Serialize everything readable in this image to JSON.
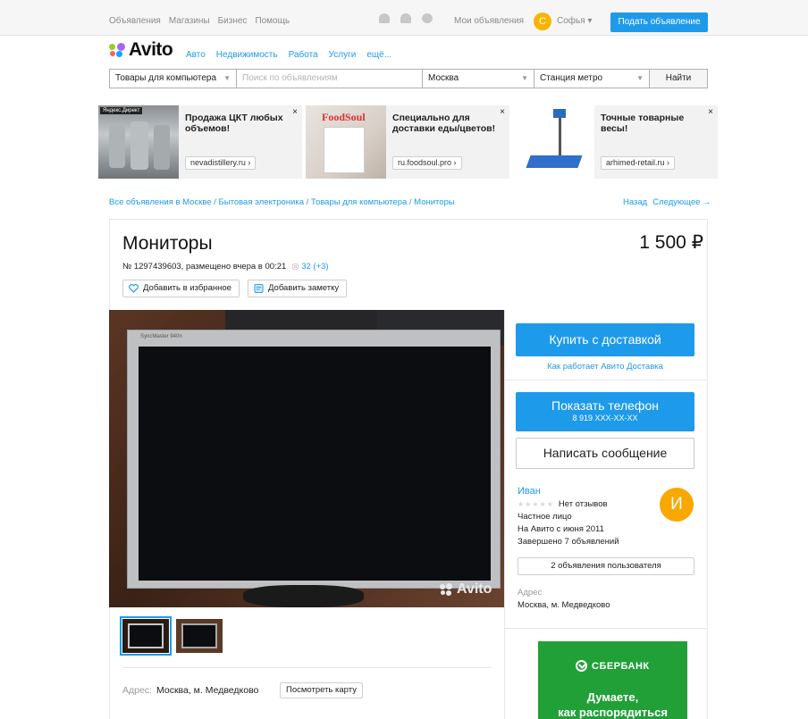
{
  "topbar": {
    "nav": [
      "Объявления",
      "Магазины",
      "Бизнес",
      "Помощь"
    ],
    "my_ads": "Мои объявления",
    "user_initial": "С",
    "user_name": "Софья ▾",
    "post_button": "Подать объявление",
    "icons": [
      "heart-icon",
      "bell-icon",
      "chat-icon"
    ]
  },
  "logo": {
    "text": "Avito"
  },
  "categories": [
    "Авто",
    "Недвижимость",
    "Работа",
    "Услуги",
    "ещё..."
  ],
  "search": {
    "category": "Товары для компьютера",
    "query_placeholder": "Поиск по объявлениям",
    "city": "Москва",
    "metro": "Станция метро",
    "find_button": "Найти"
  },
  "ads": [
    {
      "title": "Продажа ЦКТ любых объемов!",
      "link": "nevadistillery.ru ›",
      "badge": "Яндекс.Директ"
    },
    {
      "title": "Специально для доставки еды/цветов!",
      "link": "ru.foodsoul.pro ›",
      "brand": "FoodSoul"
    },
    {
      "title": "Точные товарные весы!",
      "link": "arhimed-retail.ru ›"
    }
  ],
  "breadcrumb": "Все объявления в Москве / Бытовая электроника / Товары для компьютера / Мониторы",
  "pager": {
    "back": "Назад",
    "next": "Следующее →"
  },
  "item": {
    "title": "Мониторы",
    "price": "1 500 ₽",
    "meta": "№ 1297439603, размещено вчера в 00:21",
    "views": "32 (+3)",
    "add_favorite": "Добавить в избранное",
    "add_note": "Добавить заметку",
    "photo_brand": "SyncMaster 940n",
    "watermark": "Avito",
    "address_label": "Адрес:",
    "address_value": "Москва, м. Медведково",
    "map_button": "Посмотреть карту"
  },
  "sidebar": {
    "buy_button": "Купить с доставкой",
    "delivery_link": "Как работает Авито Доставка",
    "phone_button": "Показать телефон",
    "phone_number": "8 919 XXX-XX-XX",
    "message_button": "Написать сообщение",
    "seller": {
      "name": "Иван",
      "initial": "И",
      "reviews": "Нет отзывов",
      "type": "Частное лицо",
      "since": "На Авито с июня 2011",
      "completed": "Завершено 7 объявлений",
      "ads_button": "2 объявления пользователя",
      "address_label": "Адрес",
      "address_value": "Москва, м. Медведково"
    }
  },
  "banner": {
    "brand": "СБЕРБАНК",
    "line1": "Думаете,",
    "line2": "как распорядиться"
  },
  "colors": {
    "accent": "#1e9aeb",
    "avatar_user": "#f8b400",
    "avatar_seller": "#f8a800",
    "sber": "#21a038"
  }
}
